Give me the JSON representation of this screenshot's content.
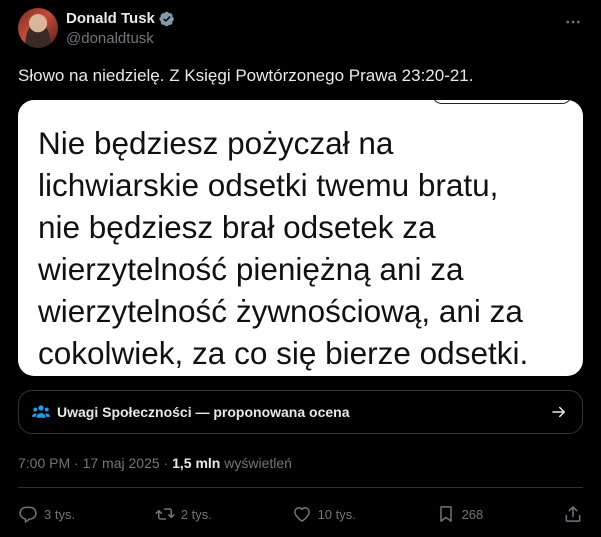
{
  "author": {
    "display_name": "Donald Tusk",
    "handle": "@donaldtusk"
  },
  "tweet": {
    "text": "Słowo na niedzielę. Z Księgi Powtórzonego Prawa 23:20-21."
  },
  "media": {
    "lines": [
      "Nie będziesz pożyczał na",
      "lichwiarskie odsetki twemu bratu,",
      "nie będziesz brał odsetek za",
      "wierzytelność pieniężną ani za",
      "wierzytelność żywnościową, ani za",
      "cokolwiek, za co się bierze odsetki."
    ]
  },
  "community_notes": {
    "label": "Uwagi Społeczności — proponowana ocena"
  },
  "meta": {
    "time": "7:00 PM",
    "separator": "·",
    "date": "17 maj 2025",
    "views_count": "1,5 mln",
    "views_label": "wyświetleń"
  },
  "actions": {
    "replies": "3 tys.",
    "reposts": "2 tys.",
    "likes": "10 tys.",
    "bookmarks": "268"
  },
  "colors": {
    "background": "#000000",
    "text": "#e7e9ea",
    "muted": "#71767b",
    "verified": "#829aab",
    "notes_icon": "#1d9bf0",
    "border": "#2f3336"
  },
  "icons": [
    "verified-badge-icon",
    "more-icon",
    "community-notes-icon",
    "arrow-right-icon",
    "reply-icon",
    "repost-icon",
    "like-icon",
    "bookmark-icon",
    "share-icon"
  ]
}
